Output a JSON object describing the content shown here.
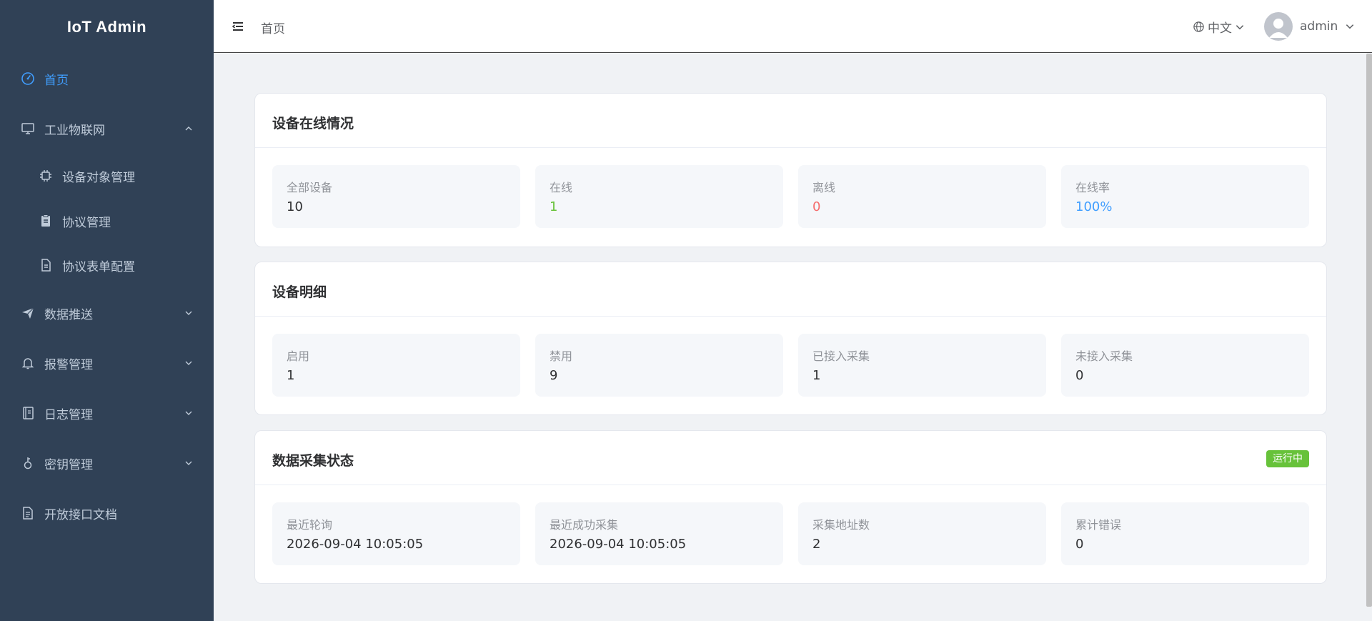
{
  "app": {
    "title": "IoT Admin"
  },
  "sidebar": {
    "items": [
      {
        "label": "首页",
        "icon": "dashboard-icon",
        "active": true
      },
      {
        "label": "工业物联网",
        "icon": "monitor-icon",
        "expanded": true
      },
      {
        "label": "设备对象管理",
        "icon": "cpu-icon",
        "sub": true
      },
      {
        "label": "协议管理",
        "icon": "clipboard-icon",
        "sub": true
      },
      {
        "label": "协议表单配置",
        "icon": "document-icon",
        "sub": true
      },
      {
        "label": "数据推送",
        "icon": "send-icon"
      },
      {
        "label": "报警管理",
        "icon": "bell-icon"
      },
      {
        "label": "日志管理",
        "icon": "notebook-icon"
      },
      {
        "label": "密钥管理",
        "icon": "key-icon"
      },
      {
        "label": "开放接口文档",
        "icon": "file-icon"
      }
    ]
  },
  "navbar": {
    "breadcrumb": "首页",
    "language": "中文",
    "username": "admin"
  },
  "cards": {
    "online": {
      "title": "设备在线情况",
      "stats": [
        {
          "label": "全部设备",
          "value": "10"
        },
        {
          "label": "在线",
          "value": "1"
        },
        {
          "label": "离线",
          "value": "0"
        },
        {
          "label": "在线率",
          "value": "100%"
        }
      ]
    },
    "detail": {
      "title": "设备明细",
      "stats": [
        {
          "label": "启用",
          "value": "1"
        },
        {
          "label": "禁用",
          "value": "9"
        },
        {
          "label": "已接入采集",
          "value": "1"
        },
        {
          "label": "未接入采集",
          "value": "0"
        }
      ]
    },
    "collect": {
      "title": "数据采集状态",
      "status_tag": "运行中",
      "stats": [
        {
          "label": "最近轮询",
          "value": "2026-09-04 10:05:05"
        },
        {
          "label": "最近成功采集",
          "value": "2026-09-04 10:05:05"
        },
        {
          "label": "采集地址数",
          "value": "2"
        },
        {
          "label": "累计错误",
          "value": "0"
        }
      ]
    }
  },
  "colors": {
    "sidebar_bg": "#304156",
    "accent": "#409eff",
    "success": "#67c23a",
    "danger": "#f56c6c"
  }
}
